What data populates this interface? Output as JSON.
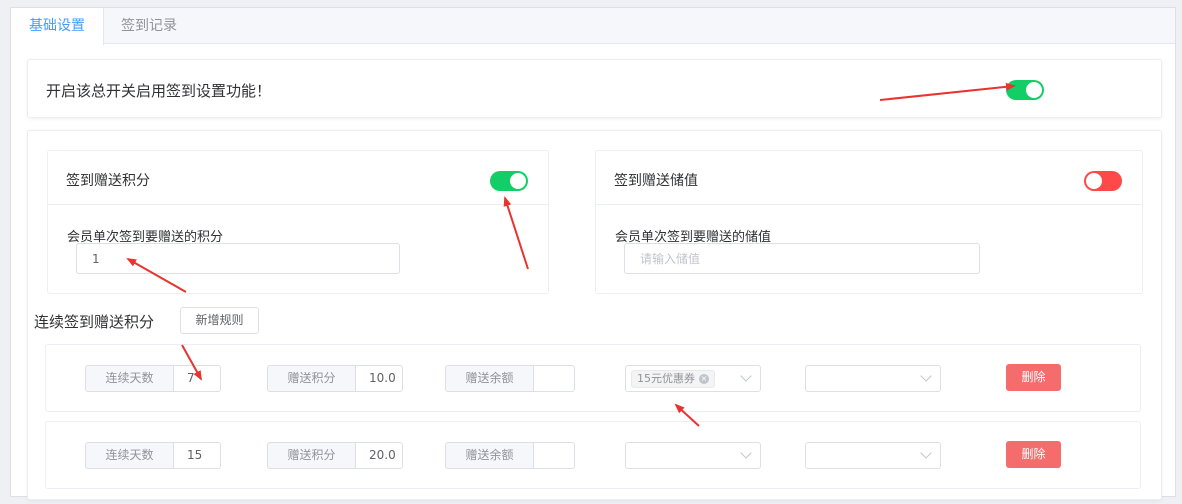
{
  "tabs": [
    {
      "label": "基础设置",
      "active": true
    },
    {
      "label": "签到记录",
      "active": false
    }
  ],
  "master": {
    "text": "开启该总开关启用签到设置功能！",
    "enabled": true
  },
  "points_card": {
    "title": "签到赠送积分",
    "enabled": true,
    "field_label": "会员单次签到要赠送的积分",
    "value": "1"
  },
  "balance_card": {
    "title": "签到赠送储值",
    "enabled": false,
    "field_label": "会员单次签到要赠送的储值",
    "placeholder": "请输入储值"
  },
  "rules_section": {
    "title": "连续签到赠送积分",
    "add_label": "新增规则"
  },
  "rules": [
    {
      "days_label": "连续天数",
      "days": "7",
      "points_label": "赠送积分",
      "points": "10.0",
      "balance_label": "赠送余额",
      "balance": "",
      "coupon_tag": "15元优惠券",
      "second_select": "",
      "delete_label": "删除"
    },
    {
      "days_label": "连续天数",
      "days": "15",
      "points_label": "赠送积分",
      "points": "20.0",
      "balance_label": "赠送余额",
      "balance": "",
      "coupon_tag": "",
      "second_select": "",
      "delete_label": "删除"
    }
  ],
  "colors": {
    "accent": "#409eff",
    "switch_on": "#13ce66",
    "switch_off": "#ff4949",
    "danger": "#f56c6c",
    "annotation_arrow": "#e8332f"
  },
  "icons": [
    "chevron-down-icon",
    "tag-close-icon",
    "annotation-arrow"
  ]
}
